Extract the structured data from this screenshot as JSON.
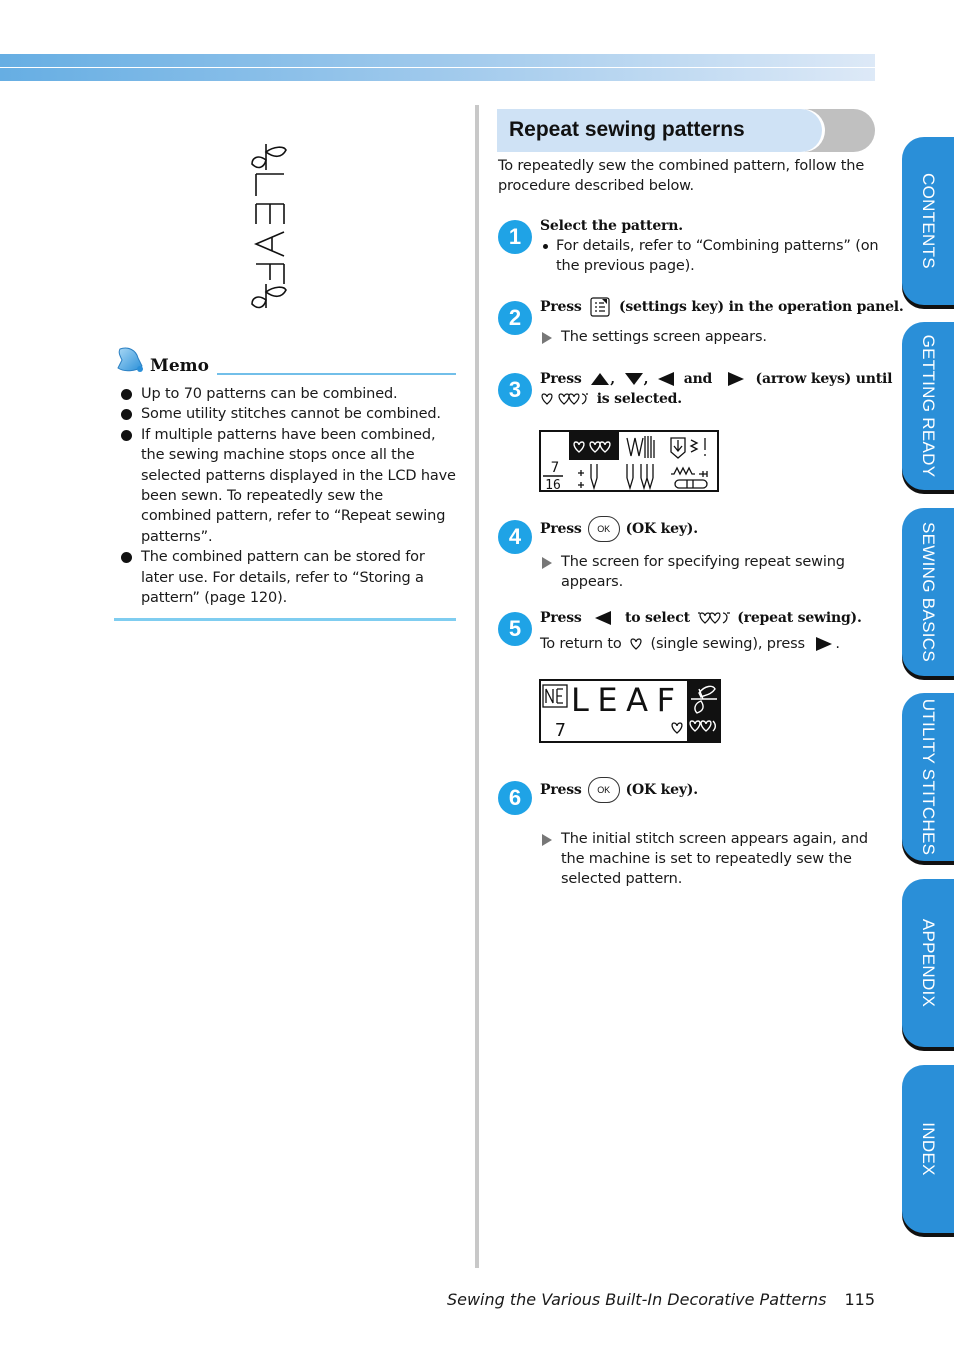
{
  "page": {
    "section_title": "Repeat sewing patterns",
    "intro": "To repeatedly sew the combined pattern, follow the procedure described below.",
    "leaf_illustration_text": "LEAF",
    "colors": {
      "accent_blue": "#1fa3e6",
      "tab_blue": "#2a8fd8",
      "section_bar_bg": "#cfe2f5",
      "memo_rule": "#72bfe9"
    }
  },
  "memo": {
    "title": "Memo",
    "items": [
      "Up to 70 patterns can be combined.",
      "Some utility stitches cannot be combined.",
      "If multiple patterns have been combined, the sewing machine stops once all the selected patterns displayed in the LCD have been sewn. To repeatedly sew the combined pattern, refer to “Repeat sewing patterns”.",
      "The combined pattern can be stored for later use. For details, refer to “Storing a pattern” (page 120)."
    ]
  },
  "steps": [
    {
      "number": "1",
      "head": "Select the pattern.",
      "bullet": "For details, refer to “Combining patterns” (on the previous page)."
    },
    {
      "number": "2",
      "head_pre": "Press",
      "head_post": "(settings key) in the operation panel.",
      "result": "The settings screen appears."
    },
    {
      "number": "3",
      "head_pre": "Press",
      "sep1": ",",
      "sep2": ",",
      "and": "and",
      "head_post": "(arrow keys) until",
      "head_line2": "is selected."
    },
    {
      "number": "4",
      "head_pre": "Press",
      "key_label": "OK",
      "head_post": "(OK key).",
      "result": "The screen for specifying repeat sewing appears."
    },
    {
      "number": "5",
      "head_pre": "Press",
      "head_mid": "to select",
      "head_post": "(repeat sewing).",
      "note_pre": "To return to",
      "note_mid": "(single sewing), press",
      "note_post": "."
    },
    {
      "number": "6",
      "head_pre": "Press",
      "key_label": "OK",
      "head_post": "(OK key).",
      "result": "The initial stitch screen appears again, and the machine is set to repeatedly sew the selected pattern."
    }
  ],
  "lcd1": {
    "fraction_top": "7",
    "fraction_bottom": "16"
  },
  "lcd2": {
    "text": "LEAF",
    "count": "7"
  },
  "footer": {
    "chapter": "Sewing the Various Built-In Decorative Patterns",
    "page_number": "115"
  },
  "side_tabs": [
    "CONTENTS",
    "GETTING READY",
    "SEWING BASICS",
    "UTILITY STITCHES",
    "APPENDIX",
    "INDEX"
  ]
}
